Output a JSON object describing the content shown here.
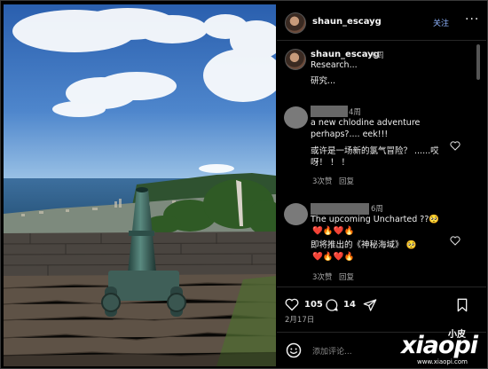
{
  "post": {
    "username": "shaun_escayg",
    "follow_label": "关注",
    "more_label": "···"
  },
  "caption": {
    "username": "shaun_escayg",
    "time": "6周",
    "text": "Research...",
    "translation": "研究..."
  },
  "comments": [
    {
      "time": "4周",
      "line1": "a new chlodine adventure",
      "line2": "perhaps?.... eek!!!",
      "trans1": "或许是一场新的氯气冒险？ ......哎",
      "trans2": "呀！ ！ ！",
      "likes": "3次赞",
      "reply": "回复"
    },
    {
      "time": "6周",
      "line1": "The upcoming Uncharted ??🥺",
      "emoji1": "❤️🔥❤️🔥",
      "trans1": "即将推出的《神秘海域》 🥺",
      "emoji2": "❤️🔥❤️🔥",
      "likes": "3次赞",
      "reply": "回复"
    }
  ],
  "actions": {
    "likes": "105",
    "comments": "14",
    "date": "2月17日"
  },
  "comment_input": {
    "placeholder": "添加评论..."
  },
  "watermark": {
    "brand": "xiaopi",
    "small": "小皮",
    "url": "www.xiaopi.com"
  }
}
